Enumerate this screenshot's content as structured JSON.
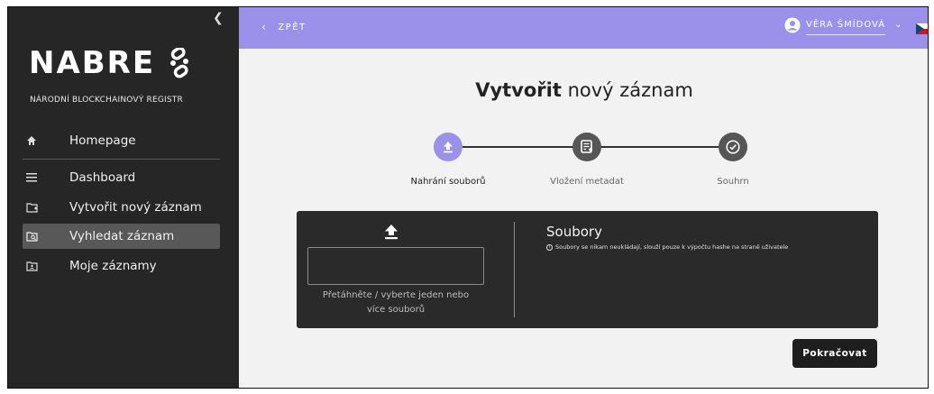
{
  "sidebar": {
    "collapse_icon": "chevron-left-icon",
    "logo_text": "NABRE",
    "subtitle": "NÁRODNÍ BLOCKCHAINOVÝ REGISTR",
    "items": [
      {
        "label": "Homepage",
        "icon": "home-icon",
        "active": false
      },
      {
        "label": "Dashboard",
        "icon": "menu-icon",
        "active": false
      },
      {
        "label": "Vytvořit nový záznam",
        "icon": "folder-add-icon",
        "active": false
      },
      {
        "label": "Vyhledat záznam",
        "icon": "folder-search-icon",
        "active": true
      },
      {
        "label": "Moje záznamy",
        "icon": "folder-user-icon",
        "active": false
      }
    ]
  },
  "topbar": {
    "back_label": "ZPĚT",
    "user_name": "VĚRA ŠMÍDOVÁ",
    "user_icon": "account-circle-icon",
    "language": "cs"
  },
  "main": {
    "title_bold": "Vytvořit",
    "title_rest": " nový záznam",
    "steps": [
      {
        "label": "Nahrání souborů",
        "icon": "upload-icon",
        "state": "active"
      },
      {
        "label": "Vložení metadat",
        "icon": "document-add-icon",
        "state": "pending"
      },
      {
        "label": "Souhrn",
        "icon": "check-circle-icon",
        "state": "pending"
      }
    ],
    "upload": {
      "hint_line1": "Přetáhněte / vyberte jeden nebo",
      "hint_line2": "více souborů"
    },
    "files": {
      "title": "Soubory",
      "note": "Soubory se nikam neukládají, slouží pouze k výpočtu hashe na straně uživatele"
    },
    "continue_label": "Pokračovat"
  },
  "colors": {
    "accent": "#9b91ea",
    "sidebar_bg": "#262626",
    "panel_bg": "#2a2a2a",
    "main_bg": "#f2f2f2"
  }
}
